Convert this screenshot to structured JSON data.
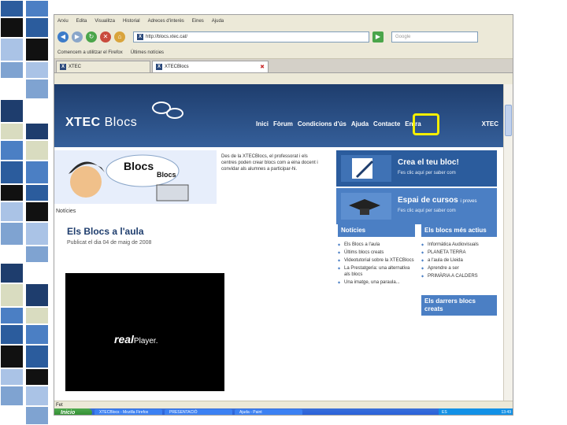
{
  "browser": {
    "menu": [
      "Arxiu",
      "Edita",
      "Visualitza",
      "Historial",
      "Adreces d'interès",
      "Eines",
      "Ajuda"
    ],
    "url": "http://blocs.xtec.cat/",
    "search_placeholder": "Google",
    "bookmarks": [
      "Comencem a utilitzar el Firefox",
      "Últimes notícies"
    ],
    "tabs": [
      "XTEC",
      "XTECBlocs"
    ]
  },
  "site": {
    "brand_bold": "XTEC",
    "brand_light": "Blocs",
    "nav": [
      "Inici",
      "Fòrum",
      "Condicions d'ús",
      "Ajuda",
      "Contacte",
      "Entra"
    ],
    "right_logo": "XTEC",
    "hero_title": "Blocs",
    "hero_subtitle": "Blocs",
    "hero_text": "Des de la XTECBlocs, el professorat i els centres poden crear blocs com a eina docent i convidar als alumnes a participar-hi.",
    "promo1": {
      "title": "Crea el teu bloc!",
      "sub": "Fes clic aquí per saber com"
    },
    "promo2": {
      "title": "Espai de cursos",
      "badge": "i proves",
      "sub": "Fes clic aquí per saber com"
    },
    "crumb": "Notícies",
    "post_title": "Els Blocs a l'aula",
    "post_date": "Publicat el dia 04 de maig de 2008",
    "video_logo": "real",
    "video_logo_rest": "Player.",
    "news_head": "Notícies",
    "news": [
      "Els Blocs a l'aula",
      "Últims blocs creats",
      "Videotutorial sobre la XTECBlocs",
      "La Prestatgeria: una alternativa als blocs",
      "Una imatge, una paraula..."
    ],
    "blogs_head": "Els blocs més actius",
    "blogs": [
      "Informàtica Audiovisuals",
      "PLANETA TERRA",
      "a l'aula de Lleida",
      "Aprendre a ser",
      "PRIMÀRIA A CALDERS"
    ],
    "recent_head": "Els darrers blocs creats"
  },
  "statusbar": {
    "text": "Fet"
  },
  "taskbar": {
    "start": "Inicio",
    "buttons": [
      "XTECBlocs - Mozilla Firefox",
      "PRESENTACIÓ",
      "Ajuda - Paint"
    ],
    "tray_lang": "ES",
    "clock": "13:49"
  },
  "colors": {
    "header": "#1e3d6d",
    "accent": "#4b7fc4",
    "highlight": "#f5ef00"
  }
}
